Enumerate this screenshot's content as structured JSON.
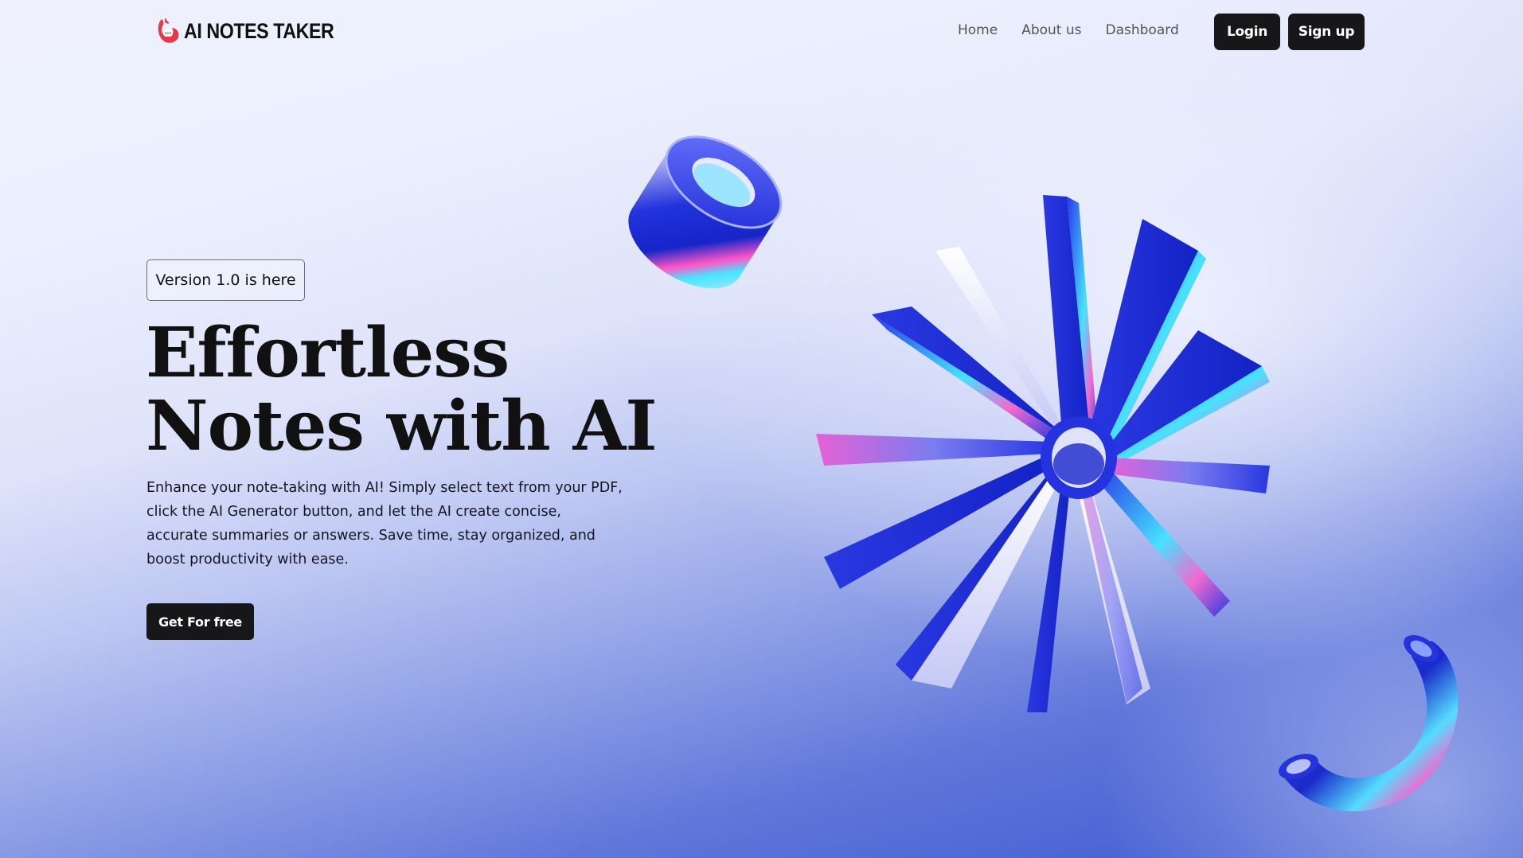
{
  "brand": {
    "name": "AI NOTES TAKER",
    "accent_color": "#e63946"
  },
  "nav": {
    "links": [
      "Home",
      "About us",
      "Dashboard"
    ],
    "login_label": "Login",
    "signup_label": "Sign up"
  },
  "hero": {
    "badge": "Version 1.0 is here",
    "title_line1": "Effortless",
    "title_line2": "Notes with AI",
    "description": "Enhance your note-taking with AI! Simply select text from your PDF, click the AI Generator button, and let the AI create concise, accurate summaries or answers. Save time, stay organized, and boost productivity with ease.",
    "cta_label": "Get For free"
  },
  "icons": {
    "logo": "flame-chat-logo-icon"
  },
  "colors": {
    "button_bg": "#17171a",
    "gradient_bottom": "#3b57cf",
    "shape_blue": "#1f2ed8"
  }
}
